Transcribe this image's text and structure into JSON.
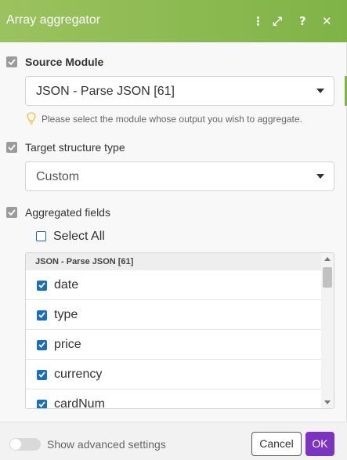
{
  "header": {
    "title": "Array aggregator",
    "icons": [
      "more-vertical-icon",
      "fullscreen-icon",
      "help-icon",
      "close-icon"
    ],
    "icon_glyphs": {
      "more": "⋮",
      "fullscreen": "⤢",
      "help": "?",
      "close": "✕"
    },
    "color": "#8ab952"
  },
  "source_module": {
    "label": "Source Module",
    "value": "JSON - Parse JSON [61]",
    "hint": "Please select the module whose output you wish to aggregate."
  },
  "target_structure": {
    "label": "Target structure type",
    "value": "Custom"
  },
  "aggregated_fields": {
    "label": "Aggregated fields",
    "select_all_label": "Select All",
    "select_all_checked": false,
    "group_header": "JSON - Parse JSON [61]",
    "fields": [
      {
        "label": "date",
        "checked": true
      },
      {
        "label": "type",
        "checked": true
      },
      {
        "label": "price",
        "checked": true
      },
      {
        "label": "currency",
        "checked": true
      },
      {
        "label": "cardNum",
        "checked": true
      }
    ]
  },
  "footer": {
    "advanced_label": "Show advanced settings",
    "advanced_enabled": false,
    "cancel_label": "Cancel",
    "ok_label": "OK",
    "ok_color": "#7a33c3"
  }
}
